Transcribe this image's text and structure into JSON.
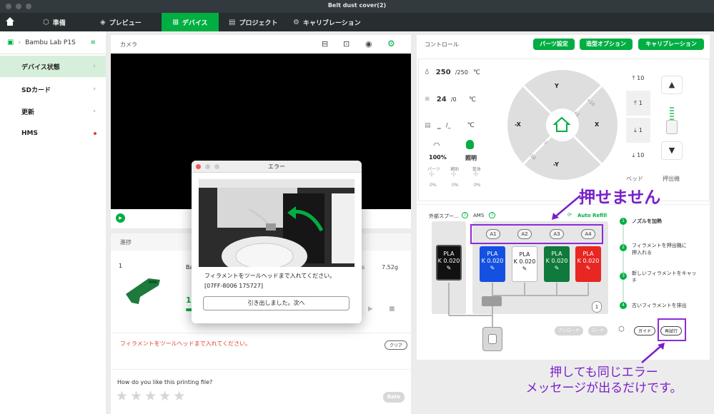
{
  "window": {
    "title": "Belt dust cover(2)"
  },
  "nav": {
    "items": [
      {
        "label": "準備"
      },
      {
        "label": "プレビュー"
      },
      {
        "label": "デバイス"
      },
      {
        "label": "プロジェクト"
      },
      {
        "label": "キャリブレーション"
      }
    ]
  },
  "sidebar": {
    "printer": "Bambu Lab P1S",
    "items": [
      {
        "label": "デバイス状態"
      },
      {
        "label": "SDカード"
      },
      {
        "label": "更新"
      },
      {
        "label": "HMS"
      }
    ]
  },
  "camera": {
    "header": "カメラ"
  },
  "progress": {
    "header": "進捗",
    "index": "1",
    "name_partial": "Ba",
    "suffix_partial": "s",
    "weight": "7.52g",
    "percent_partial": "1",
    "error_message": "フィラメントをツールヘッドまで入れてください。",
    "clear_label": "クリア",
    "rate_prompt": "How do you like this printing file?",
    "rate_label": "Rate"
  },
  "control": {
    "header": "コントロール",
    "buttons": [
      "パーツ設定",
      "造型オプション",
      "キャリブレーション"
    ],
    "nozzle": {
      "current": "250",
      "target": "/250",
      "unit": "℃"
    },
    "bed": {
      "current": "24",
      "target": "/0",
      "unit": "℃"
    },
    "chamber": {
      "current": "_",
      "target": "/_",
      "unit": "℃"
    },
    "speed": "100%",
    "light": "照明",
    "fans": [
      {
        "label": "パーツ",
        "value": "0%"
      },
      {
        "label": "補助",
        "value": "0%"
      },
      {
        "label": "筐体",
        "value": "0%"
      }
    ],
    "jog": {
      "y": "Y",
      "neg_y": "-Y",
      "x": "X",
      "neg_x": "-X",
      "p10": "+10",
      "p1": "+1",
      "m1": "-1",
      "m10": "-10"
    },
    "bed_steps": [
      "10",
      "1",
      "1",
      "10"
    ],
    "bed_label": "ベッド",
    "extruder_label": "押出機"
  },
  "ams": {
    "ext_label": "外部スプー…",
    "ams_label": "AMS",
    "auto_refill": "Auto Refill",
    "ext_slot": {
      "material": "PLA",
      "k": "K 0.020",
      "color": "#111111"
    },
    "slots": [
      {
        "id": "A1",
        "material": "PLA",
        "k": "K 0.020",
        "color": "#1451e0"
      },
      {
        "id": "A2",
        "material": "PLA",
        "k": "K 0.020",
        "color": "#ffffff"
      },
      {
        "id": "A3",
        "material": "PLA",
        "k": "K 0.020",
        "color": "#0f7a3c"
      },
      {
        "id": "A4",
        "material": "PLA",
        "k": "K 0.020",
        "color": "#e82622"
      }
    ],
    "unit_number": "1",
    "steps": [
      "ノズルを加熱",
      "フィラメントを押出機に押入れる",
      "新しいフィラメントをキャッチ",
      "古いフィラメントを排出"
    ],
    "step_nums": [
      "1",
      "2",
      "3",
      "4"
    ],
    "unload_label": "アンロード",
    "load_label": "ロード",
    "guide_label": "ガイド",
    "retry_label": "再試行"
  },
  "modal": {
    "title": "エラー",
    "message": "フィラメントをツールヘッドまで入れてください。",
    "code": "[07FF-8006 175727]",
    "button": "引き出しました。次へ"
  },
  "annotations": {
    "cannot_press": "押せません",
    "same_error_line1": "押しても同じエラー",
    "same_error_line2": "メッセージが出るだけです。"
  }
}
